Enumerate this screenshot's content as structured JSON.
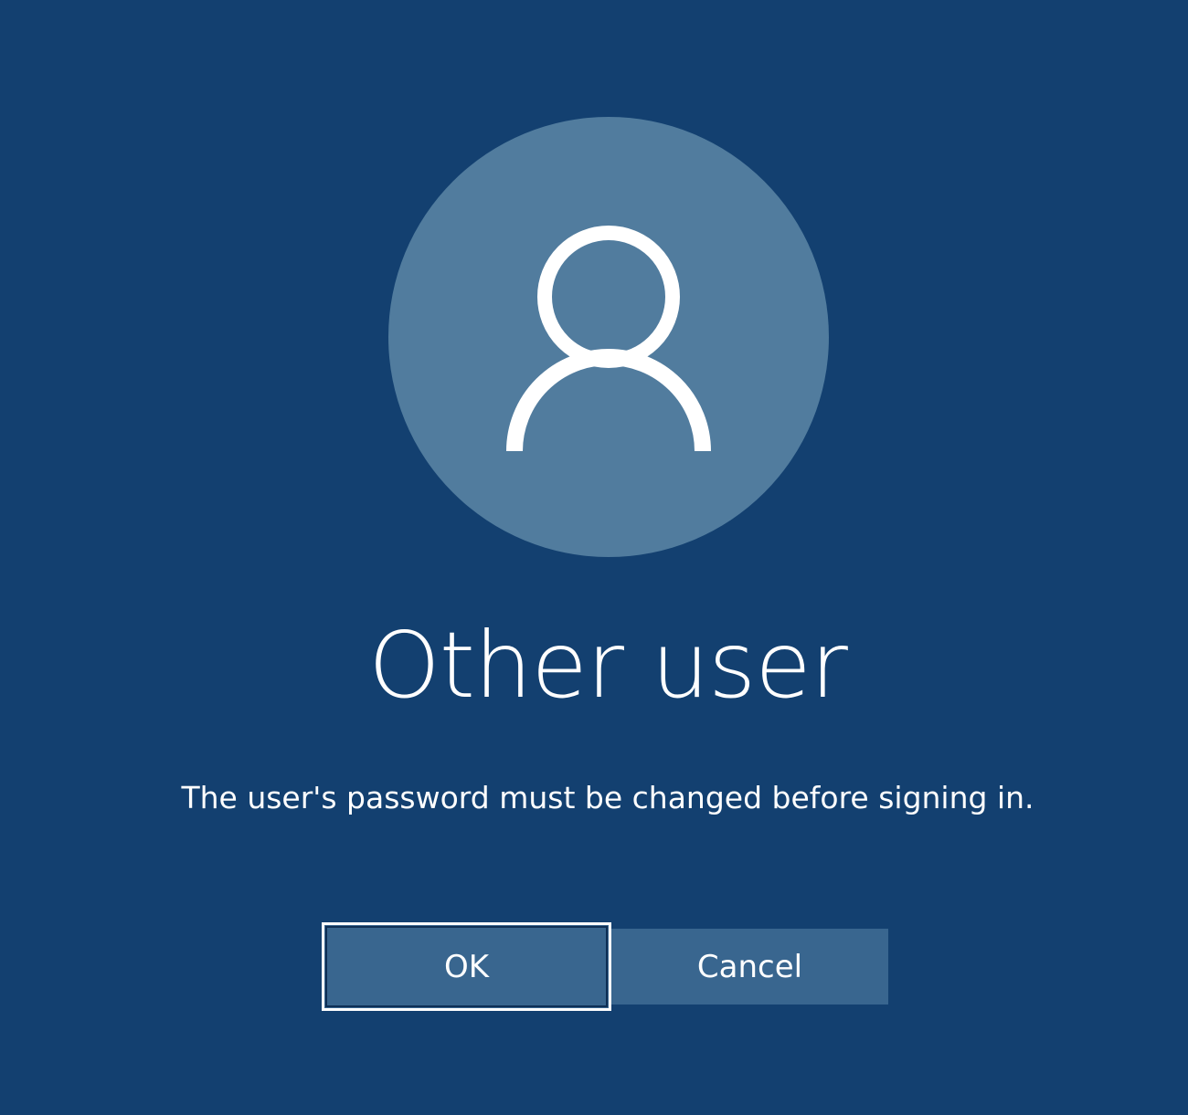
{
  "screen": {
    "background_color": "#134070"
  },
  "avatar": {
    "icon": "user-icon",
    "circle_color": "#517c9e"
  },
  "user": {
    "name": "Other user"
  },
  "message": {
    "text": "The user's password must be changed before signing in."
  },
  "buttons": {
    "ok_label": "OK",
    "cancel_label": "Cancel",
    "button_color": "#39668f"
  }
}
